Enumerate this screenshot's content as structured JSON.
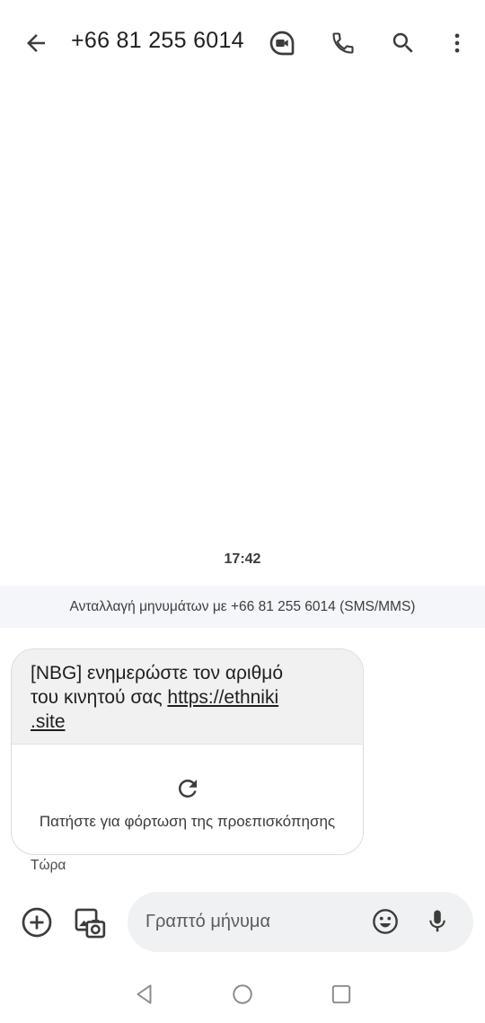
{
  "header": {
    "title": "+66 81 255 6014",
    "icons": [
      "back-arrow-icon",
      "video-call-icon",
      "phone-icon",
      "search-icon",
      "more-vert-icon"
    ]
  },
  "conversation": {
    "timestamp": "17:42",
    "info_bar": "Ανταλλαγή μηνυμάτων με +66 81 255 6014 (SMS/MMS)",
    "message": {
      "text_line1": "[NBG] ενημερώστε τον αριθμό",
      "text_line2_prefix": "του κινητού σας ",
      "link_part1": "https://ethniki",
      "link_part2": ".site",
      "preview_label": "Πατήστε για φόρτωση της προεπισκόπησης",
      "time": "Τώρα"
    }
  },
  "composer": {
    "placeholder": "Γραπτό μήνυμα",
    "icons": [
      "add-icon",
      "gallery-icon",
      "emoji-icon",
      "mic-icon"
    ]
  },
  "navbar": {
    "icons": [
      "nav-back-icon",
      "nav-home-icon",
      "nav-recents-icon"
    ]
  },
  "colors": {
    "background": "#ffffff",
    "bubble": "#f1f1f2",
    "info_bar": "#f4f6f9",
    "composer": "#f0f1f3",
    "icon": "#3c3c3c"
  }
}
